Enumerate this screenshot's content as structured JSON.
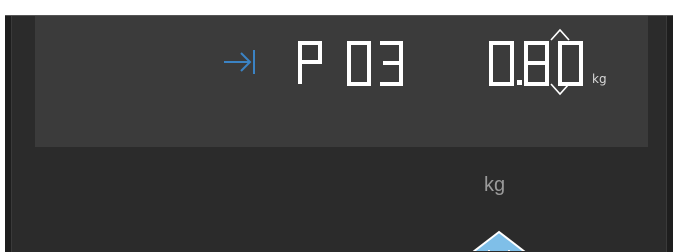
{
  "display": {
    "program": "P03",
    "weight": "0.80",
    "weight_unit": "kg"
  },
  "control": {
    "unit_label": "kg"
  },
  "icons": {
    "end_icon": "arrow-to-end-icon",
    "adjust_icon": "up-down-chevron-icon",
    "pointer_icon": "up-arrow-icon"
  },
  "colors": {
    "icon_blue": "#3b83c4",
    "segment_white": "#ffffff",
    "screen_bg": "#3b3b3b",
    "body_bg": "#2b2b2b",
    "arrow_fill": "#7fbfe8",
    "label_gray": "#9a9a9a"
  }
}
